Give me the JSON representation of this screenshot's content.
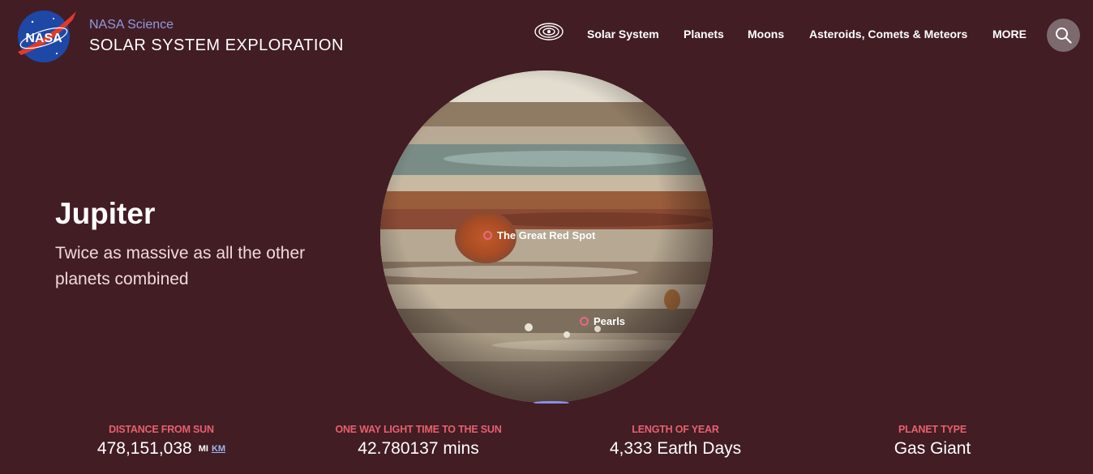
{
  "header": {
    "logo_text": "NASA",
    "brand_sub": "NASA Science",
    "brand_title": "SOLAR SYSTEM EXPLORATION",
    "nav": [
      "Solar System",
      "Planets",
      "Moons",
      "Asteroids, Comets & Meteors",
      "MORE"
    ],
    "icons": {
      "orbit": "orbit-icon",
      "search": "search-icon"
    }
  },
  "hero": {
    "title": "Jupiter",
    "tagline": "Twice as massive as all the other planets combined"
  },
  "hotspots": [
    "The Great Red Spot",
    "Pearls"
  ],
  "stats": [
    {
      "label": "DISTANCE FROM SUN",
      "value": "478,151,038",
      "unit_mi": "MI",
      "unit_km": "KM"
    },
    {
      "label": "ONE WAY LIGHT TIME TO THE SUN",
      "value": "42.780137 mins"
    },
    {
      "label": "LENGTH OF YEAR",
      "value": "4,333 Earth Days"
    },
    {
      "label": "PLANET TYPE",
      "value": "Gas Giant"
    }
  ],
  "colors": {
    "background": "#421d24",
    "accent": "#e7606e",
    "brand_sub": "#8f9ae0",
    "hotspot_ring": "#e86a86"
  }
}
